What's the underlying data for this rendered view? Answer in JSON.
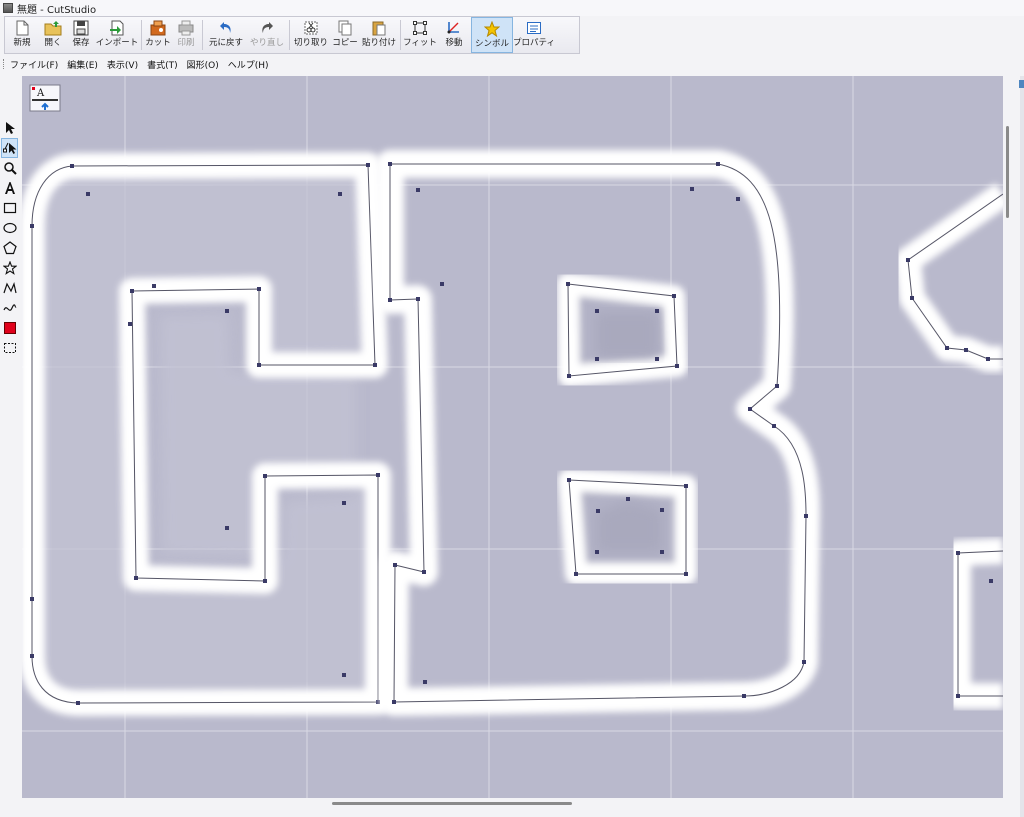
{
  "window": {
    "title": "無題 - CutStudio"
  },
  "toolbar": {
    "buttons": [
      {
        "label": "新規",
        "icon": "new-document-icon"
      },
      {
        "label": "開く",
        "icon": "open-folder-icon"
      },
      {
        "label": "保存",
        "icon": "save-disk-icon"
      },
      {
        "label": "インポート",
        "icon": "import-icon"
      },
      {
        "label": "カット",
        "icon": "cut-icon"
      },
      {
        "label": "印刷",
        "icon": "print-icon",
        "disabled": true
      },
      {
        "label": "元に戻す",
        "icon": "undo-icon"
      },
      {
        "label": "やり直し",
        "icon": "redo-icon",
        "disabled": true
      },
      {
        "label": "切り取り",
        "icon": "scissors-icon"
      },
      {
        "label": "コピー",
        "icon": "copy-icon"
      },
      {
        "label": "貼り付け",
        "icon": "paste-icon"
      },
      {
        "label": "フィット",
        "icon": "fit-icon"
      },
      {
        "label": "移動",
        "icon": "move-icon"
      },
      {
        "label": "シンボル",
        "icon": "star-icon",
        "active": true
      },
      {
        "label": "プロパティ",
        "icon": "properties-icon"
      }
    ]
  },
  "menu": {
    "file": "ファイル(F)",
    "edit": "編集(E)",
    "view": "表示(V)",
    "format": "書式(T)",
    "shape": "図形(O)",
    "help": "ヘルプ(H)"
  },
  "tools": [
    {
      "icon": "select-arrow-icon"
    },
    {
      "icon": "node-edit-icon",
      "active": true
    },
    {
      "icon": "zoom-icon"
    },
    {
      "icon": "text-tool-icon"
    },
    {
      "icon": "rectangle-tool-icon"
    },
    {
      "icon": "ellipse-tool-icon"
    },
    {
      "icon": "polygon-tool-icon"
    },
    {
      "icon": "star-tool-icon"
    },
    {
      "icon": "polyline-tool-icon"
    },
    {
      "icon": "curve-tool-icon"
    },
    {
      "icon": "color-swatch-icon"
    },
    {
      "icon": "marquee-tool-icon"
    }
  ],
  "canvas": {
    "corner_badge": "A",
    "colors": {
      "background": "#b9b9cc",
      "grid": "#d9d9e4",
      "glow": "#ffffff",
      "path": "#555566",
      "node": "#3a3a66",
      "swatch": "#e0001b"
    }
  }
}
